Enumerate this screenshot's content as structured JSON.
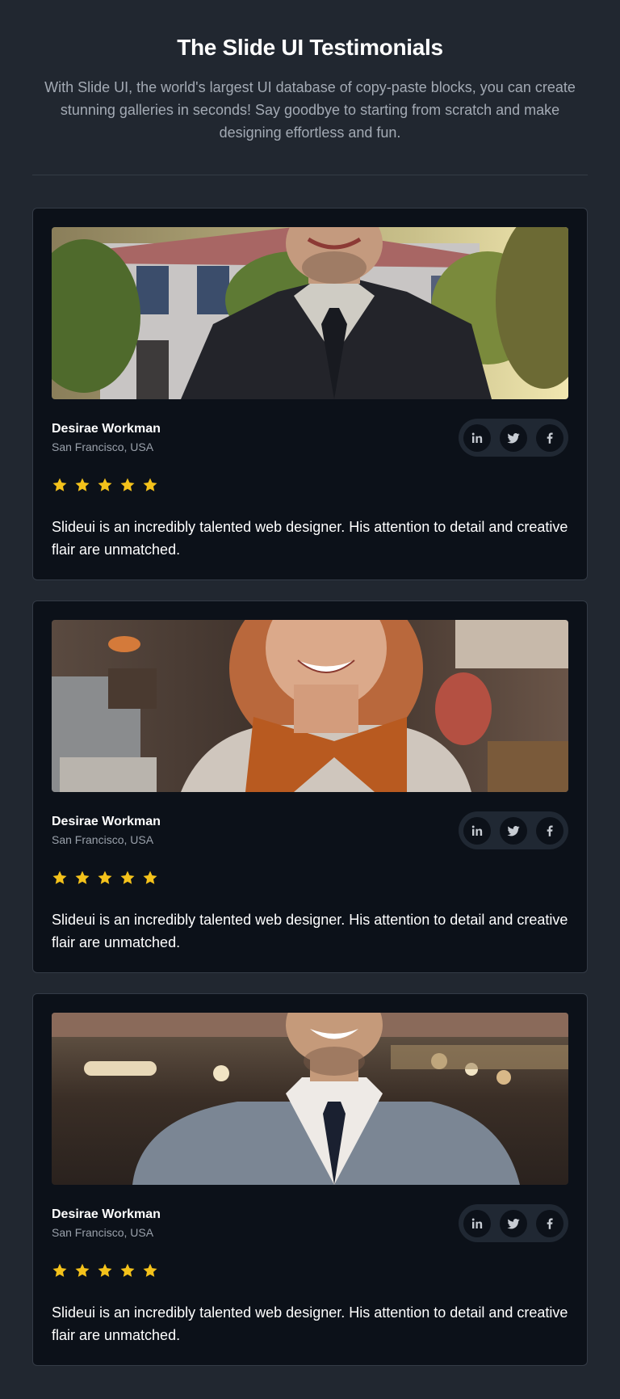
{
  "header": {
    "title": "The Slide UI Testimonials",
    "subtitle": "With Slide UI, the world's largest UI database of copy-paste blocks, you can create stunning galleries in seconds! Say goodbye to starting from scratch and make designing effortless and fun."
  },
  "colors": {
    "background": "#212730",
    "card": "#0c1119",
    "border": "#343b46",
    "star": "#f4c21b",
    "muted_text": "#a3aab4"
  },
  "testimonials": [
    {
      "photo": "man-dark-suit-house-photo",
      "name": "Desirae Workman",
      "location": "San Francisco, USA",
      "rating": 5,
      "quote": "Slideui is an incredibly talented web designer. His attention to detail and creative flair are unmatched.",
      "socials": [
        "linkedin-icon",
        "twitter-icon",
        "facebook-icon"
      ]
    },
    {
      "photo": "woman-orange-scarf-cafe-photo",
      "name": "Desirae Workman",
      "location": "San Francisco, USA",
      "rating": 5,
      "quote": "Slideui is an incredibly talented web designer. His attention to detail and creative flair are unmatched.",
      "socials": [
        "linkedin-icon",
        "twitter-icon",
        "facebook-icon"
      ]
    },
    {
      "photo": "man-grey-suit-store-photo",
      "name": "Desirae Workman",
      "location": "San Francisco, USA",
      "rating": 5,
      "quote": "Slideui is an incredibly talented web designer. His attention to detail and creative flair are unmatched.",
      "socials": [
        "linkedin-icon",
        "twitter-icon",
        "facebook-icon"
      ]
    }
  ]
}
